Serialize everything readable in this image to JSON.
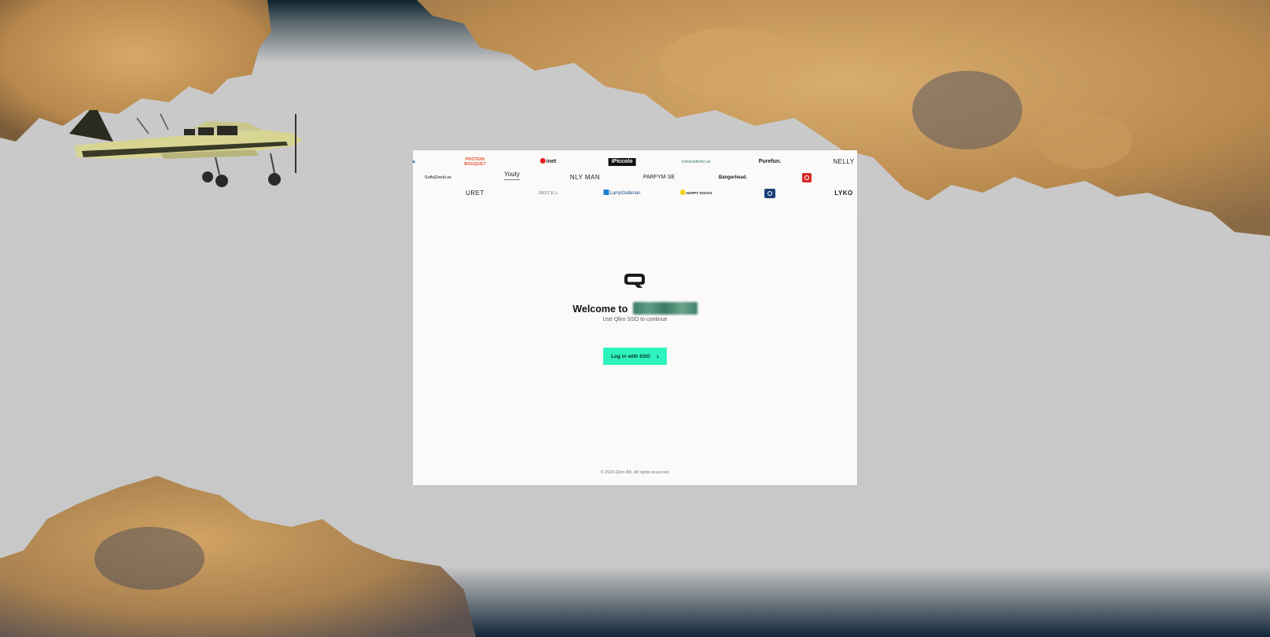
{
  "brand_logos": {
    "row1": [
      "PROTEIN BOUQUET",
      "inet",
      "iPiccolo",
      "bokadirekt.se",
      "Purefun.",
      "NELLY"
    ],
    "row2": [
      "SoffaDirekt.se",
      "Youty",
      "NLY MAN",
      "PARFYM·SE",
      "Bangerhead."
    ],
    "row3": [
      "URET",
      "BRECKA",
      "LampGallerian",
      "HAPPY SOCKS",
      "LYKO"
    ]
  },
  "main": {
    "welcome_prefix": "Welcome to",
    "subtitle": "Use Qliro SSO to continue",
    "sso_button_label": "Log in with SSO",
    "chevron": "›"
  },
  "footer": {
    "copyright": "© 2024 Qliro AB. All rights reserved."
  },
  "colors": {
    "accent": "#2ff3bf",
    "card_background": "#fbfaf8",
    "page_background": "#c8c8c8"
  }
}
